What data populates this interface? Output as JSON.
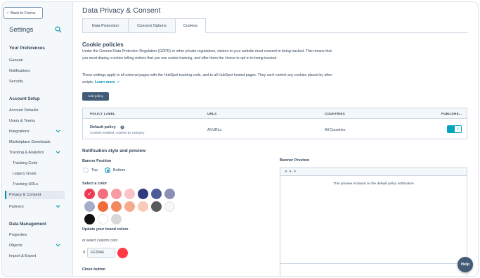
{
  "sidebar": {
    "back_label": "Back to Forms",
    "title": "Settings",
    "sections": [
      {
        "heading": "Your Preferences",
        "items": [
          "General",
          "Notifications",
          "Security"
        ]
      },
      {
        "heading": "Account Setup",
        "items": [
          "Account Defaults",
          "Users & Teams",
          "Integrations",
          "Marketplace Downloads",
          "Tracking & Analytics",
          "Tracking Code",
          "Legacy Goals",
          "Tracking URLs",
          "Privacy & Consent",
          "Partners"
        ]
      },
      {
        "heading": "Data Management",
        "items": [
          "Properties",
          "Objects",
          "Import & Export"
        ]
      }
    ],
    "active_item": "Privacy & Consent"
  },
  "main": {
    "title": "Data Privacy & Consent",
    "tabs": [
      {
        "label": "Data Protection"
      },
      {
        "label": "Consent Options"
      },
      {
        "label": "Cookies"
      }
    ],
    "active_tab": "Cookies",
    "cookie_policies": {
      "heading": "Cookie policies",
      "para1": "Under the General Data Protection Regulation (GDPR) or other private regulations, visitors to your website must consent to being tracked. This means that you must display a notice telling visitors that you use cookie tracking, and offer them the choice to opt in to being tracked.",
      "para2": "These settings apply to all external pages with the HubSpot tracking code, and to all HubSpot hosted pages. They can't control any cookies placed by other scripts.",
      "learn_more": "Learn more.",
      "add_policy": "Add policy"
    },
    "table": {
      "headers": [
        "POLICY LABEL",
        "URLS",
        "COUNTRIES",
        "PUBLISHE..."
      ],
      "rows": [
        {
          "label": "Default policy",
          "sub": "Cookies enabled, cookies by category",
          "urls": "All URLs",
          "countries": "All Countries",
          "published": true
        }
      ]
    },
    "notification": {
      "heading": "Notification style and preview",
      "position_label": "Banner Position",
      "positions": [
        "Top",
        "Bottom"
      ],
      "selected_position": "Bottom",
      "color_label": "Select a color",
      "swatch_colors": [
        [
          "#ee3a52",
          "#f5707e",
          "#f89ba4",
          "#fbc3c8",
          "#2f3a7e",
          "#4e5998",
          "#8a8fb6"
        ],
        [
          "#a6acc7",
          "#f26b3a",
          "#f28a5f",
          "#f6ab8c",
          "#f9cbb8",
          "#5a5a5a",
          "#f7f7f7"
        ],
        [
          "#111111",
          "#ffffff",
          "#d8d8d8"
        ]
      ],
      "selected_color": "#ee3a52",
      "brand_link": "Update your brand colors",
      "custom_label": "or select custom color",
      "hash": "#",
      "custom_value": "FF3946",
      "custom_color": "#ff3946",
      "close_button_label": "Close button"
    },
    "preview": {
      "label": "Banner Preview",
      "text": "This preview is based on the default policy notification",
      "dots": "● ● ●"
    }
  },
  "help": "Help"
}
